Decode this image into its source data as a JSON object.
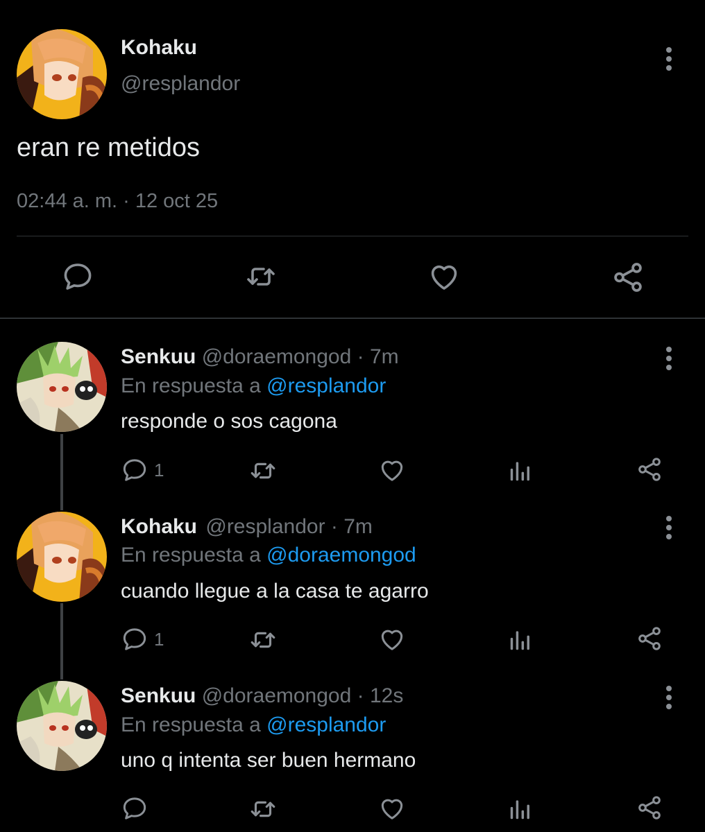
{
  "main_tweet": {
    "author_name": "Kohaku",
    "author_handle": "@resplandor",
    "text": "eran re metidos",
    "timestamp": "02:44 a. m. · 12 oct 25",
    "avatar_icon": "kohaku-avatar",
    "actions": [
      "reply-icon",
      "retweet-icon",
      "like-icon",
      "share-icon"
    ]
  },
  "replies": [
    {
      "author_name": "Senkuu",
      "handle_time": "@doraemongod · 7m",
      "reply_prefix": "En respuesta a",
      "reply_to": "@resplandor",
      "text": "responde o sos cagona",
      "reply_count": "1",
      "avatar_icon": "senkuu-avatar"
    },
    {
      "author_name": "Kohaku",
      "handle_time": "@resplandor · 7m",
      "reply_prefix": "En respuesta a",
      "reply_to": "@doraemongod",
      "text": "cuando llegue a la casa te agarro",
      "reply_count": "1",
      "avatar_icon": "kohaku-avatar"
    },
    {
      "author_name": "Senkuu",
      "handle_time": "@doraemongod · 12s",
      "reply_prefix": "En respuesta a",
      "reply_to": "@resplandor",
      "text": "uno q intenta ser buen hermano",
      "reply_count": "",
      "avatar_icon": "senkuu-avatar"
    }
  ],
  "colors": {
    "background": "#000000",
    "text": "#e7e9ea",
    "secondary": "#71767b",
    "link": "#1d9bf0",
    "divider": "#2f3336"
  }
}
